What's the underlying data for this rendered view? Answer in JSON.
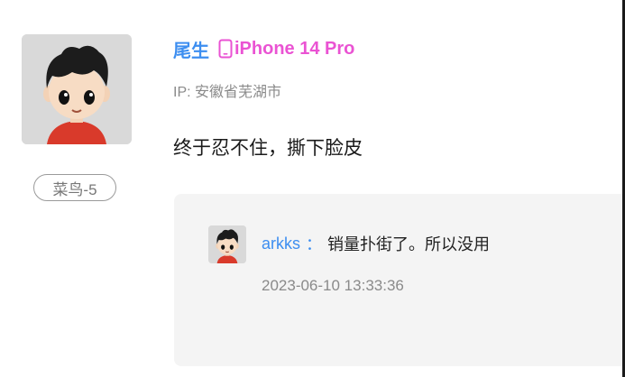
{
  "comment": {
    "username": "尾生",
    "device": "iPhone 14 Pro",
    "device_icon": "phone-icon",
    "ip": "IP: 安徽省芜湖市",
    "text": "终于忍不住，撕下脸皮",
    "level": "菜鸟-5"
  },
  "reply": {
    "username": "arkks",
    "separator": "：",
    "text": "销量扑街了。所以没用",
    "time": "2023-06-10 13:33:36"
  },
  "colors": {
    "username": "#3d8ef0",
    "device": "#ea53d3",
    "meta": "#8a8a8a",
    "reply_bg": "#f4f4f4"
  }
}
